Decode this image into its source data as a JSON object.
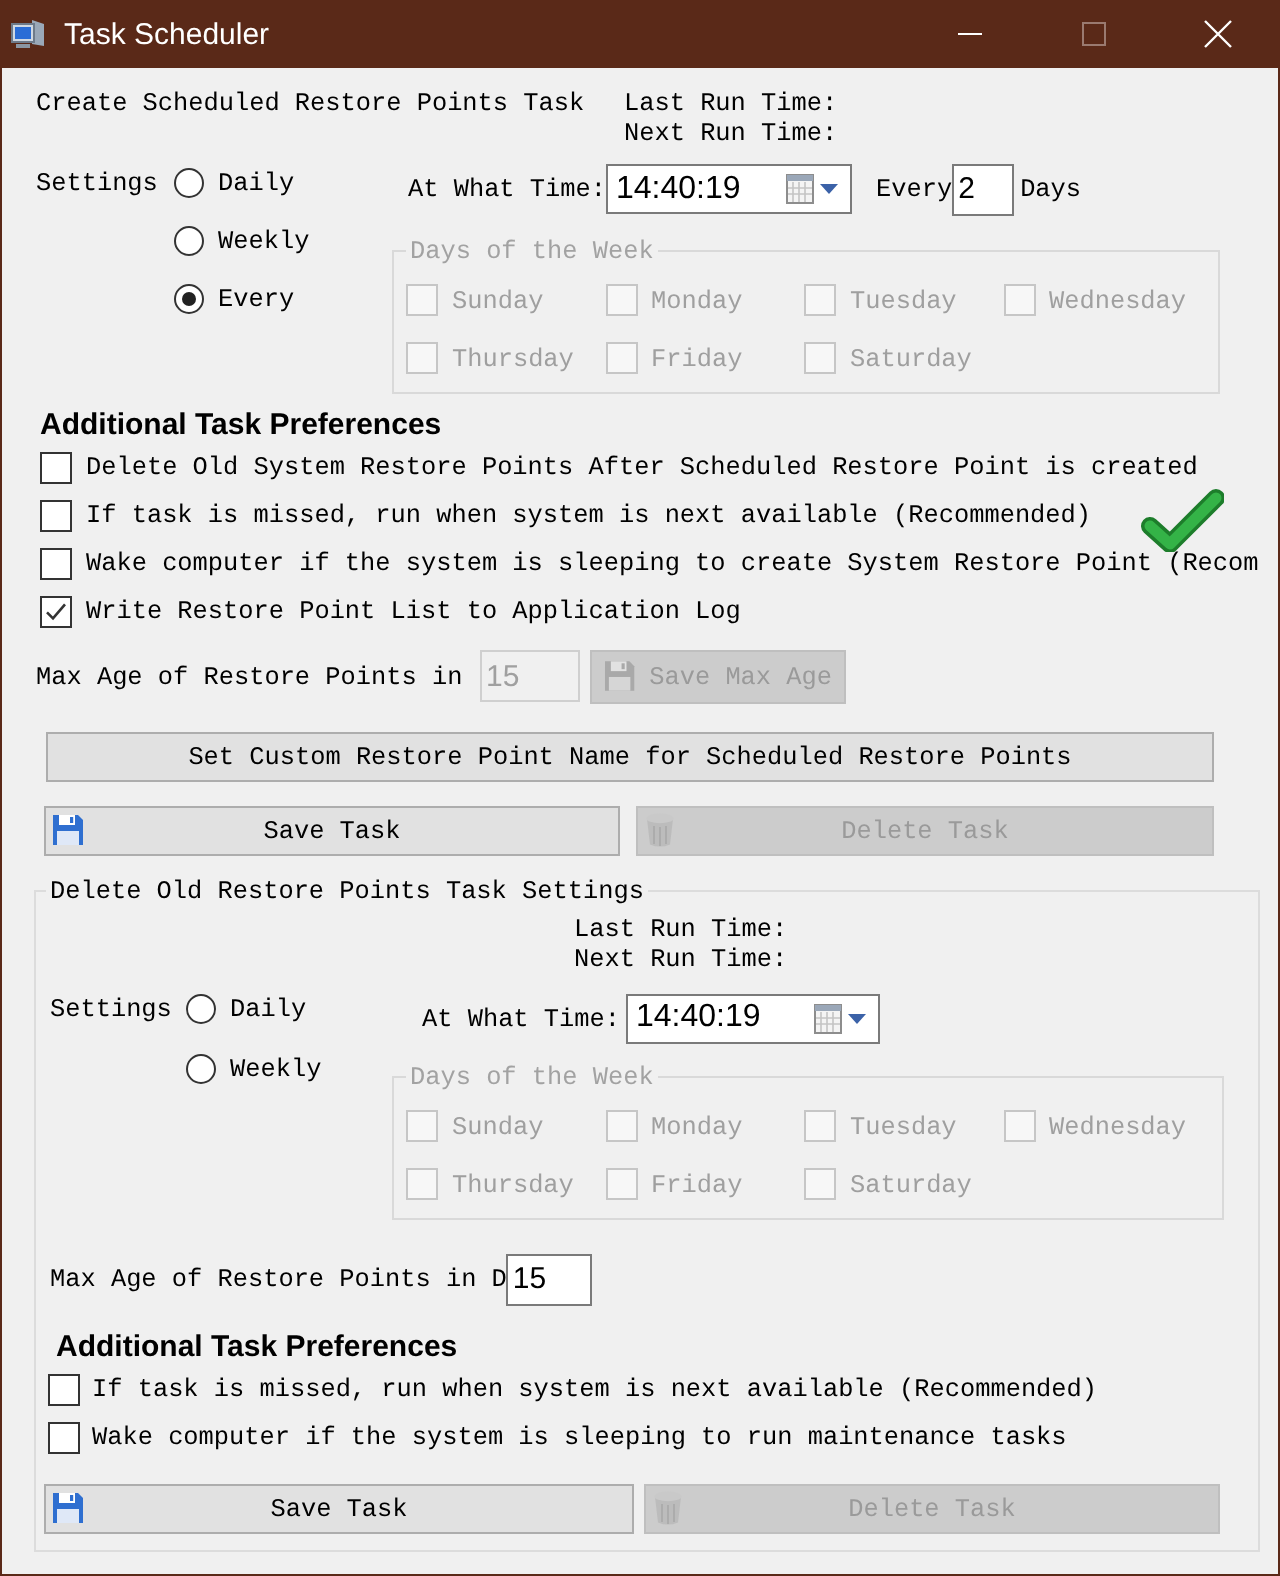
{
  "window": {
    "title": "Task Scheduler",
    "controls": [
      {
        "kind": "minimize",
        "disabled": false
      },
      {
        "kind": "maximize",
        "disabled": true
      },
      {
        "kind": "close",
        "disabled": false
      }
    ]
  },
  "create_task": {
    "title": "Create Scheduled Restore Points Task",
    "last_run_label": "Last Run Time:",
    "next_run_label": "Next Run Time:",
    "settings_label": "Settings",
    "frequency": [
      {
        "label": "Daily",
        "selected": false
      },
      {
        "label": "Weekly",
        "selected": false
      },
      {
        "label": "Every",
        "selected": true
      }
    ],
    "time_label": "At What Time:",
    "time_value": "14:40:19",
    "interval": {
      "label": "Every",
      "value": "2",
      "unit": "Days"
    },
    "days_of_week": {
      "title": "Days of the Week",
      "disabled": true,
      "days": [
        {
          "label": "Sunday",
          "checked": false
        },
        {
          "label": "Monday",
          "checked": false
        },
        {
          "label": "Tuesday",
          "checked": false
        },
        {
          "label": "Wednesday",
          "checked": false
        },
        {
          "label": "Thursday",
          "checked": false
        },
        {
          "label": "Friday",
          "checked": false
        },
        {
          "label": "Saturday",
          "checked": false
        }
      ]
    },
    "preferences_title": "Additional Task Preferences",
    "preferences": [
      {
        "label": "Delete Old System Restore Points After Scheduled Restore Point is created",
        "checked": false
      },
      {
        "label": "If task is missed, run when system is next available (Recommended)",
        "checked": false
      },
      {
        "label": "Wake computer if the system is sleeping to create System Restore Point (Recom",
        "checked": false
      },
      {
        "label": "Write Restore Point List to Application Log",
        "checked": true
      }
    ],
    "max_age": {
      "label": "Max Age of Restore Points in",
      "value": "15",
      "disabled": true
    },
    "save_max_age_button": {
      "kind": "save",
      "label": "Save Max Age",
      "disabled": true
    },
    "custom_name_button": {
      "label": "Set Custom Restore Point Name for Scheduled Restore Points",
      "disabled": false
    },
    "actions": [
      {
        "kind": "save",
        "label": "Save Task",
        "disabled": false
      },
      {
        "kind": "delete",
        "label": "Delete Task",
        "disabled": true
      }
    ]
  },
  "delete_task": {
    "title": "Delete Old Restore Points Task Settings",
    "last_run_label": "Last Run Time:",
    "next_run_label": "Next Run Time:",
    "settings_label": "Settings",
    "frequency": [
      {
        "label": "Daily",
        "selected": false
      },
      {
        "label": "Weekly",
        "selected": false
      }
    ],
    "time_label": "At What Time:",
    "time_value": "14:40:19",
    "days_of_week": {
      "title": "Days of the Week",
      "disabled": true,
      "days": [
        {
          "label": "Sunday",
          "checked": false
        },
        {
          "label": "Monday",
          "checked": false
        },
        {
          "label": "Tuesday",
          "checked": false
        },
        {
          "label": "Wednesday",
          "checked": false
        },
        {
          "label": "Thursday",
          "checked": false
        },
        {
          "label": "Friday",
          "checked": false
        },
        {
          "label": "Saturday",
          "checked": false
        }
      ]
    },
    "max_age": {
      "label": "Max Age of Restore Points in D",
      "value": "15",
      "disabled": false
    },
    "preferences_title": "Additional Task Preferences",
    "preferences": [
      {
        "label": "If task is missed, run when system is next available (Recommended)",
        "checked": false
      },
      {
        "label": "Wake computer if the system is sleeping to run maintenance tasks",
        "checked": false
      }
    ],
    "actions": [
      {
        "kind": "save",
        "label": "Save Task",
        "disabled": false
      },
      {
        "kind": "delete",
        "label": "Delete Task",
        "disabled": true
      }
    ]
  }
}
